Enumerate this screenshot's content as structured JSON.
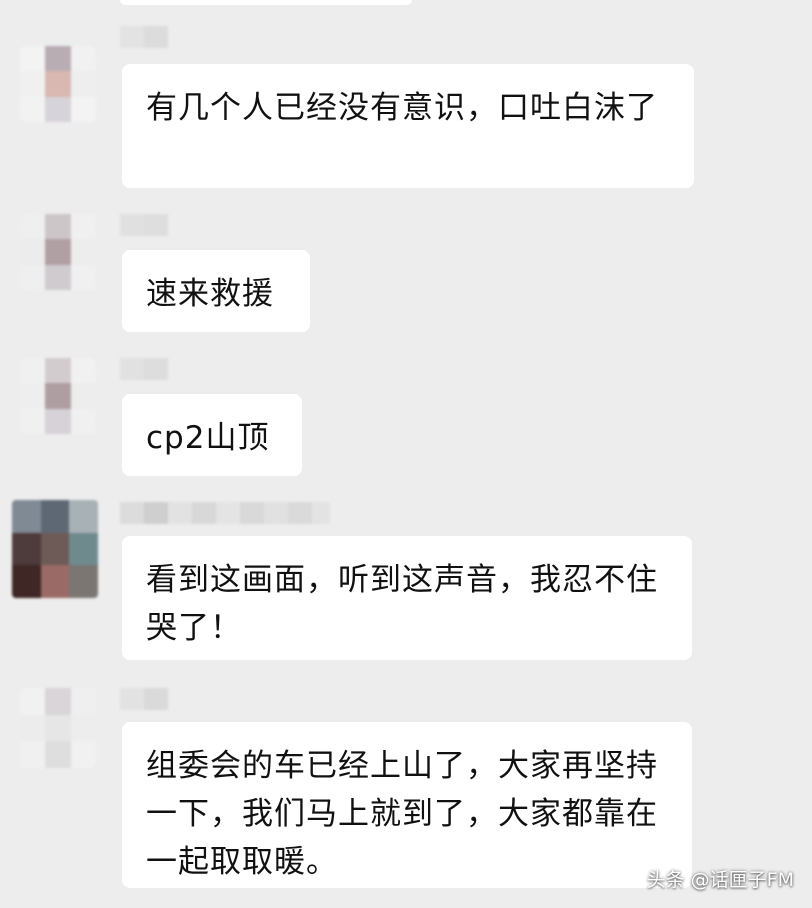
{
  "messages": [
    {
      "text": "有几个人已经没有意识，口吐白沫了"
    },
    {
      "text": "速来救援"
    },
    {
      "text": "cp2山顶"
    },
    {
      "text": "看到这画面，听到这声音，我忍不住哭了！"
    },
    {
      "text": "组委会的车已经上山了，大家再坚持一下，我们马上就到了，大家都靠在一起取取暖。"
    }
  ],
  "watermark": "头条 @话匣子FM",
  "colors": {
    "background": "#ededed",
    "bubble": "#ffffff",
    "text": "#111111"
  }
}
